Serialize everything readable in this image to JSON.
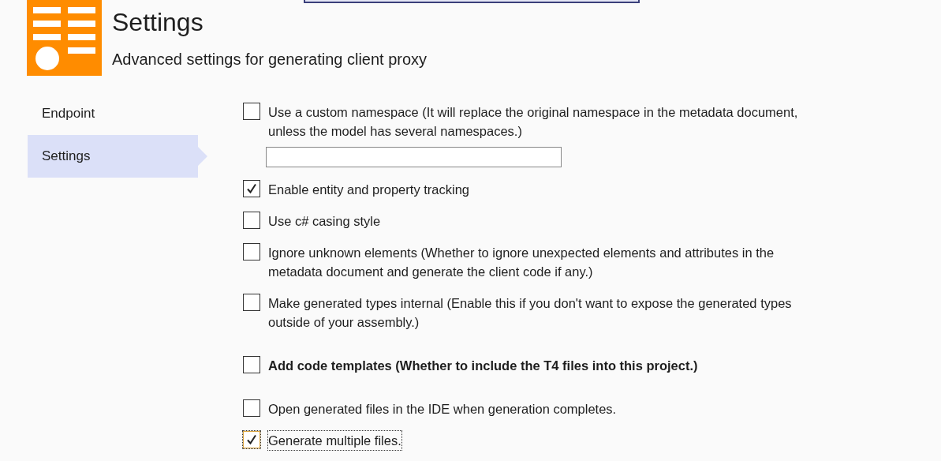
{
  "header": {
    "title": "Settings",
    "subtitle": "Advanced settings for generating client proxy"
  },
  "sidebar": {
    "items": [
      {
        "label": "Endpoint",
        "selected": false
      },
      {
        "label": "Settings",
        "selected": true
      }
    ]
  },
  "option_groups": [
    {
      "options": [
        {
          "kind": "checkbox-with-field",
          "label": "Use a custom namespace (It will replace the original namespace in the metadata document, unless the model has several namespaces.)",
          "checked": false,
          "bold": false,
          "focused": false
        },
        {
          "kind": "checkbox",
          "label": "Enable entity and property tracking",
          "checked": true,
          "bold": false,
          "focused": false
        },
        {
          "kind": "checkbox",
          "label": "Use c# casing style",
          "checked": false,
          "bold": false,
          "focused": false
        },
        {
          "kind": "checkbox",
          "label": "Ignore unknown elements (Whether to ignore unexpected elements and attributes in the metadata document and generate the client code if any.)",
          "checked": false,
          "bold": false,
          "focused": false
        },
        {
          "kind": "checkbox",
          "label": "Make generated types internal (Enable this if you don't want to expose the generated types outside of your assembly.)",
          "checked": false,
          "bold": false,
          "focused": false
        }
      ]
    },
    {
      "options": [
        {
          "kind": "checkbox",
          "label": "Add code templates (Whether to include the T4 files into this project.)",
          "checked": false,
          "bold": true,
          "focused": false
        }
      ]
    },
    {
      "options": [
        {
          "kind": "checkbox",
          "label": "Open generated files in the IDE when generation completes.",
          "checked": false,
          "bold": false,
          "focused": false
        },
        {
          "kind": "checkbox",
          "label": "Generate multiple files.",
          "checked": true,
          "bold": false,
          "focused": true
        }
      ]
    }
  ]
}
